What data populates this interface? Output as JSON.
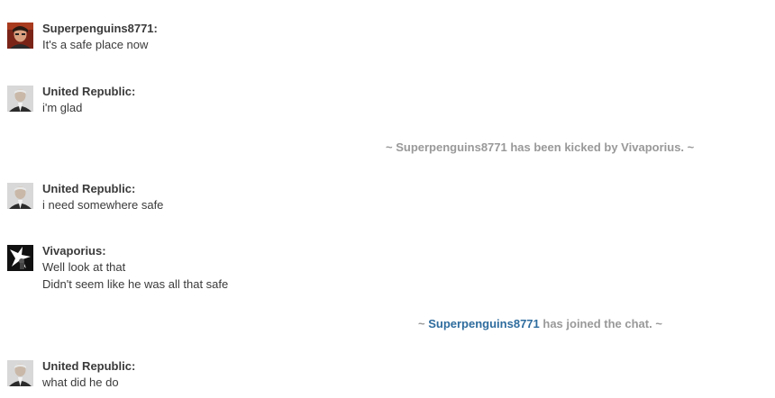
{
  "messages": [
    {
      "user": "Superpenguins8771:",
      "lines": [
        "It's a safe place now"
      ]
    },
    {
      "user": "United Republic:",
      "lines": [
        "i'm glad"
      ]
    },
    {
      "user": "United Republic:",
      "lines": [
        "i need somewhere safe"
      ]
    },
    {
      "user": "Vivaporius:",
      "lines": [
        "Well look at that",
        "Didn't seem like he was all that safe"
      ]
    },
    {
      "user": "United Republic:",
      "lines": [
        "what did he do"
      ]
    }
  ],
  "alerts": {
    "kick": "~ Superpenguins8771 has been kicked by Vivaporius. ~",
    "join_prefix": "~ ",
    "join_user": "Superpenguins8771",
    "join_suffix": " has joined the chat. ~"
  },
  "avatars": {
    "superpenguins": "portrait-icon",
    "united_republic": "portrait-icon",
    "vivaporius": "star-silhouette-icon"
  },
  "colors": {
    "text": "#3a3a3a",
    "alert": "#999999",
    "link": "#2e6c9e"
  }
}
